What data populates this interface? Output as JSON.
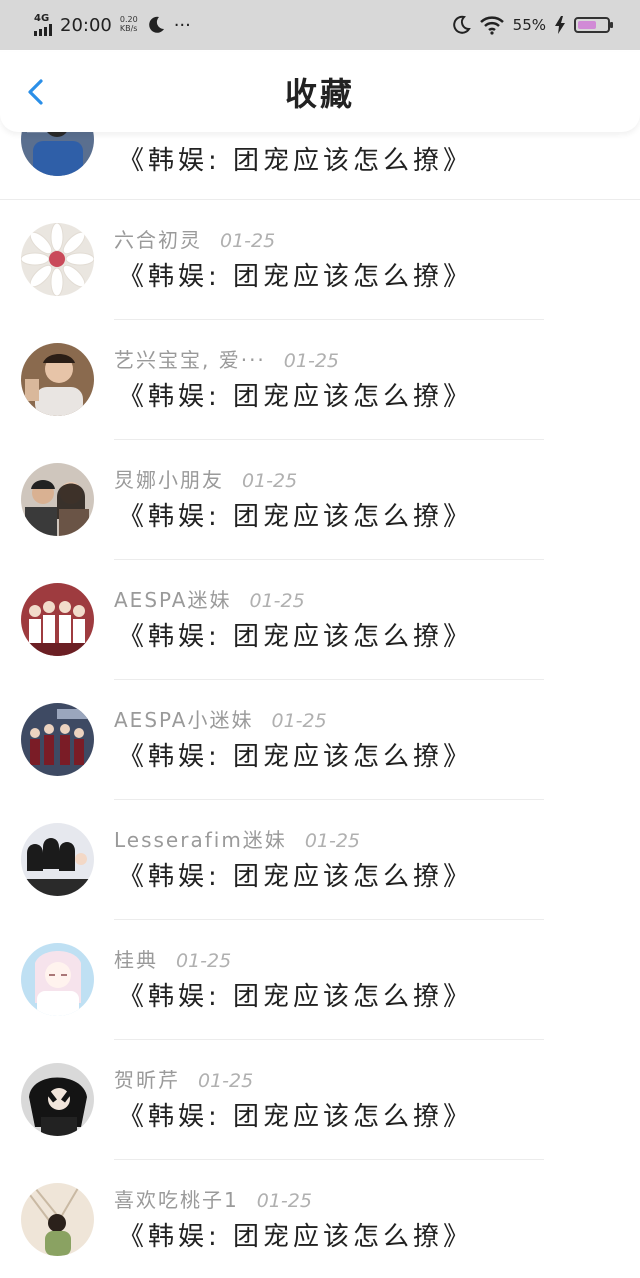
{
  "status": {
    "network": "4G",
    "time": "20:00",
    "speed_top": "0.20",
    "speed_bottom": "KB/s",
    "more": "···",
    "battery": "55%"
  },
  "header": {
    "title": "收藏"
  },
  "items": [
    {
      "name": "",
      "date": "",
      "post": "《韩娱: 团宠应该怎么撩》"
    },
    {
      "name": "六合初灵",
      "date": "01-25",
      "post": "《韩娱: 团宠应该怎么撩》"
    },
    {
      "name": "艺兴宝宝, 爱···",
      "date": "01-25",
      "post": "《韩娱: 团宠应该怎么撩》"
    },
    {
      "name": "炅娜小朋友",
      "date": "01-25",
      "post": "《韩娱: 团宠应该怎么撩》"
    },
    {
      "name": "AESPA迷妹",
      "date": "01-25",
      "post": "《韩娱: 团宠应该怎么撩》"
    },
    {
      "name": "AESPA小迷妹",
      "date": "01-25",
      "post": "《韩娱: 团宠应该怎么撩》"
    },
    {
      "name": "Lesserafim迷妹",
      "date": "01-25",
      "post": "《韩娱: 团宠应该怎么撩》"
    },
    {
      "name": "桂典",
      "date": "01-25",
      "post": "《韩娱: 团宠应该怎么撩》"
    },
    {
      "name": "贺昕芹",
      "date": "01-25",
      "post": "《韩娱: 团宠应该怎么撩》"
    },
    {
      "name": "喜欢吃桃子1",
      "date": "01-25",
      "post": "《韩娱: 团宠应该怎么撩》"
    }
  ],
  "colors": {
    "accent": "#2b8fe8",
    "status_bar": "#d8d8d8",
    "meta_text": "#9a9a9a"
  },
  "icons": {
    "back": "chevron-left-icon",
    "moon": "moon-icon",
    "wifi": "wifi-icon",
    "charging": "lightning-icon",
    "battery": "battery-icon"
  }
}
